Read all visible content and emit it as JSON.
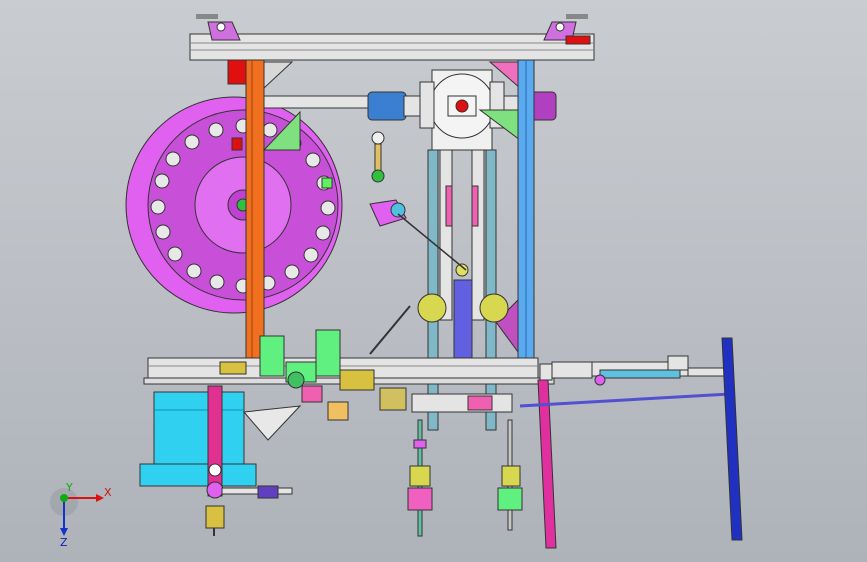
{
  "viewport": {
    "background": "#bfc3c8"
  },
  "triad": {
    "x_label": "X",
    "y_label": "Y",
    "z_label": "Z",
    "x_color": "#dd1111",
    "y_color": "#11aa11",
    "z_color": "#1133cc"
  },
  "colors": {
    "frame_gray": "#e2e2e2",
    "reel_magenta": "#e060f0",
    "column_orange": "#f07020",
    "column_blue": "#5aaaf0",
    "motor_blue": "#3a7fd0",
    "motor_purple": "#b040c0",
    "base_cyan": "#30d0f0",
    "green_parts": "#60f080",
    "pink_parts": "#f060b0",
    "blue_leg": "#2030c0",
    "yellow_parts": "#d8c040",
    "red_parts": "#e01010"
  }
}
